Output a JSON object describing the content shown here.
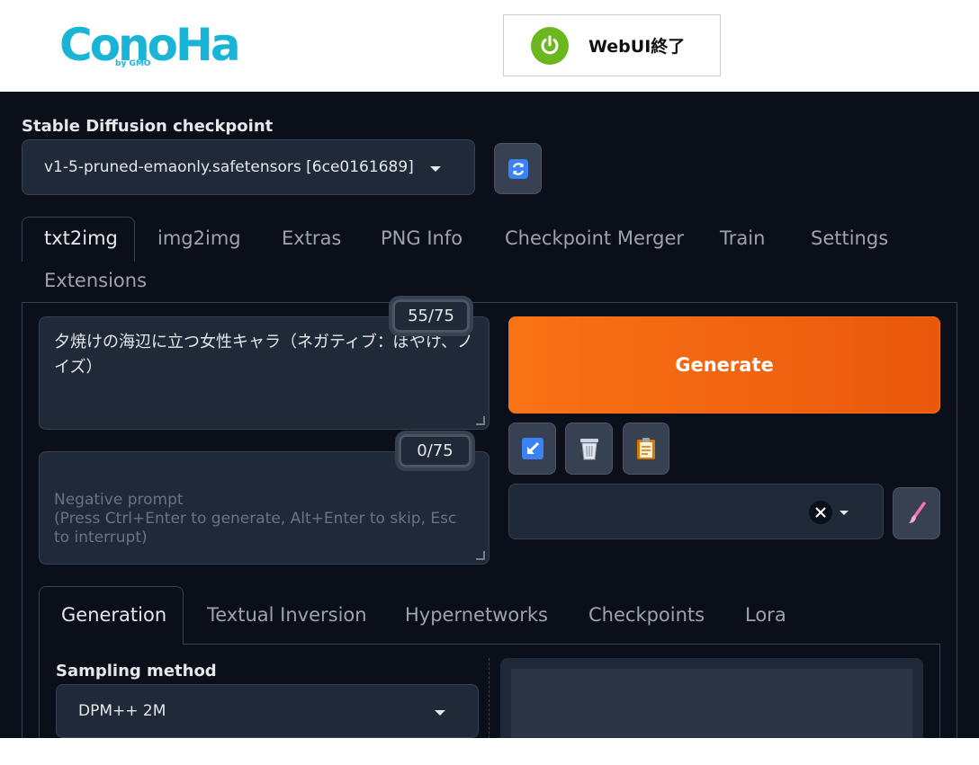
{
  "header": {
    "logo_text": "ConoHa",
    "logo_by": "by GMO",
    "quit_label": "WebUI終了"
  },
  "checkpoint": {
    "label": "Stable Diffusion checkpoint",
    "value": "v1-5-pruned-emaonly.safetensors [6ce0161689]"
  },
  "tabs": [
    {
      "label": "txt2img"
    },
    {
      "label": "img2img"
    },
    {
      "label": "Extras"
    },
    {
      "label": "PNG Info"
    },
    {
      "label": "Checkpoint Merger"
    },
    {
      "label": "Train"
    },
    {
      "label": "Settings"
    },
    {
      "label": "Extensions"
    }
  ],
  "prompt": {
    "counter": "55/75",
    "value": "夕焼けの海辺に立つ女性キャラ（ネガティブ：ぼやけ、ノイズ）"
  },
  "negative_prompt": {
    "counter": "0/75",
    "placeholder": "Negative prompt\n(Press Ctrl+Enter to generate, Alt+Enter to skip, Esc to interrupt)"
  },
  "generate_label": "Generate",
  "subtabs": [
    {
      "label": "Generation"
    },
    {
      "label": "Textual Inversion"
    },
    {
      "label": "Hypernetworks"
    },
    {
      "label": "Checkpoints"
    },
    {
      "label": "Lora"
    }
  ],
  "sampling": {
    "label": "Sampling method",
    "value": "DPM++ 2M"
  },
  "colors": {
    "accent": "#f97316",
    "background": "#0b0f19",
    "surface": "#1f2937",
    "logo": "#1ab4d6",
    "power": "#6ab71e"
  }
}
